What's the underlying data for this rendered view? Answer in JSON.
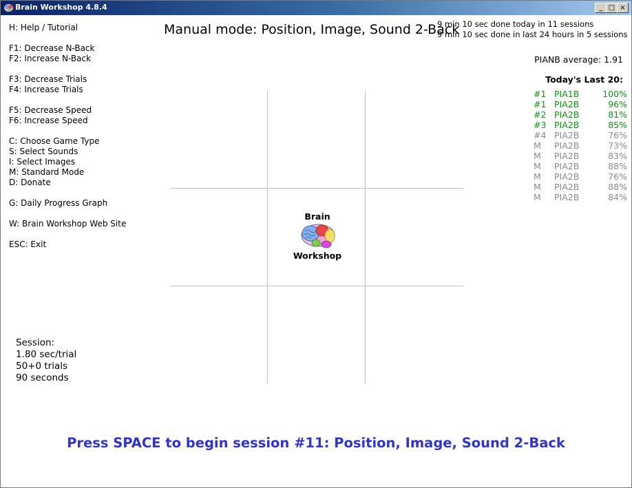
{
  "window": {
    "title": "Brain Workshop 4.8.4",
    "controls": [
      "_",
      "□",
      "×"
    ]
  },
  "menu": {
    "help": "H: Help / Tutorial",
    "dec_nback": "F1: Decrease N-Back",
    "inc_nback": "F2: Increase N-Back",
    "dec_trials": "F3: Decrease Trials",
    "inc_trials": "F4: Increase Trials",
    "dec_speed": "F5: Decrease Speed",
    "inc_speed": "F6: Increase Speed",
    "game_type": "C: Choose Game Type",
    "sounds": "S: Select Sounds",
    "images": "I: Select Images",
    "standard_mode": "M: Standard Mode",
    "donate": "D: Donate",
    "graph": "G: Daily Progress Graph",
    "website": "W: Brain Workshop Web Site",
    "exit": "ESC: Exit"
  },
  "header": {
    "mode_title": "Manual mode: Position, Image, Sound 2-Back",
    "today": "9 min 10 sec done today in 11 sessions",
    "last24": "9 min 10 sec done in last 24 hours in 5 sessions",
    "average": "PIANB average: 1.91"
  },
  "last20": {
    "title": "Today's Last 20:",
    "rows": [
      {
        "rank": "#1",
        "mode": "PIA1B",
        "pct": "100%",
        "color": "#0a9a0a"
      },
      {
        "rank": "#1",
        "mode": "PIA2B",
        "pct": "96%",
        "color": "#0a9a0a"
      },
      {
        "rank": "#2",
        "mode": "PIA2B",
        "pct": "81%",
        "color": "#0a9a0a"
      },
      {
        "rank": "#3",
        "mode": "PIA2B",
        "pct": "85%",
        "color": "#0a9a0a"
      },
      {
        "rank": "#4",
        "mode": "PIA2B",
        "pct": "76%",
        "color": "#8c8c8c"
      },
      {
        "rank": "M",
        "mode": "PIA2B",
        "pct": "73%",
        "color": "#8c8c8c"
      },
      {
        "rank": "M",
        "mode": "PIA2B",
        "pct": "83%",
        "color": "#8c8c8c"
      },
      {
        "rank": "M",
        "mode": "PIA2B",
        "pct": "88%",
        "color": "#8c8c8c"
      },
      {
        "rank": "M",
        "mode": "PIA2B",
        "pct": "76%",
        "color": "#8c8c8c"
      },
      {
        "rank": "M",
        "mode": "PIA2B",
        "pct": "88%",
        "color": "#8c8c8c"
      },
      {
        "rank": "M",
        "mode": "PIA2B",
        "pct": "84%",
        "color": "#8c8c8c"
      }
    ]
  },
  "logo": {
    "word1": "Brain",
    "word2": "Workshop",
    "icon": "brain-icon"
  },
  "session": {
    "label": "Session:",
    "speed": "1.80 sec/trial",
    "trials": "50+0 trials",
    "duration": "90 seconds"
  },
  "prompt": "Press SPACE to begin session #11: Position, Image, Sound 2-Back",
  "colors": {
    "prompt": "#2e34d6",
    "rank_good": "#0a9a0a",
    "rank_manual": "#8c8c8c",
    "grid": "#c0c0c0"
  }
}
